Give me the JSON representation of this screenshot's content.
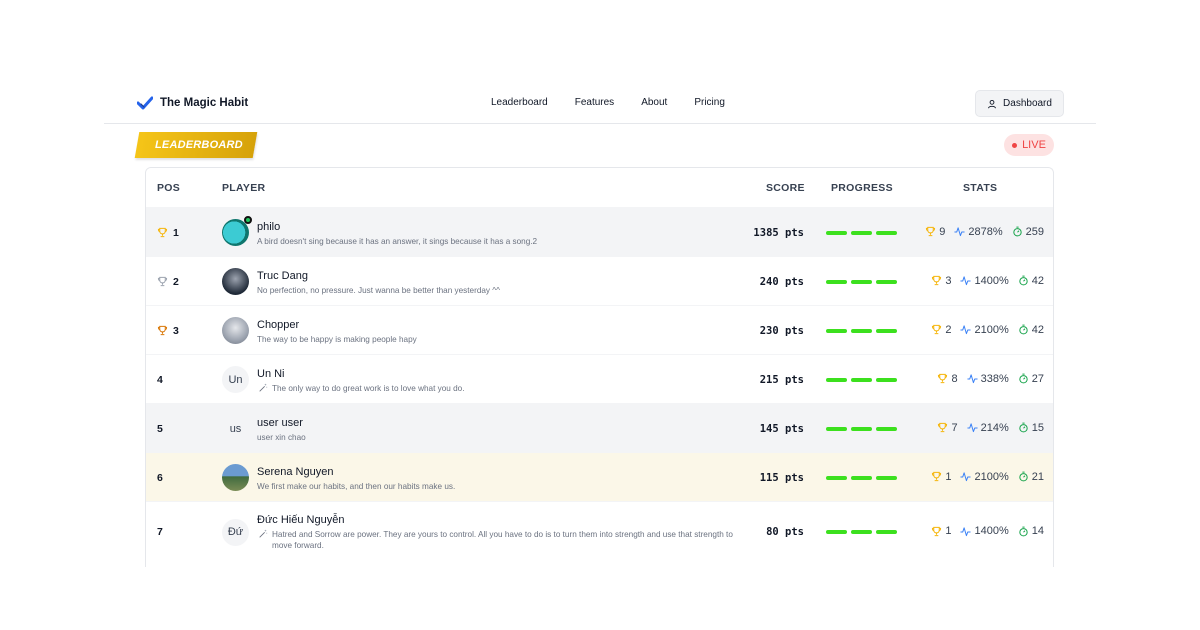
{
  "brand": {
    "name": "The Magic Habit"
  },
  "nav": {
    "links": [
      "Leaderboard",
      "Features",
      "About",
      "Pricing"
    ],
    "dashboard_label": "Dashboard"
  },
  "banner": {
    "title": "LEADERBOARD",
    "live_label": "LIVE"
  },
  "table": {
    "headers": {
      "pos": "POS",
      "player": "PLAYER",
      "score": "SCORE",
      "progress": "PROGRESS",
      "stats": "STATS"
    },
    "rows": [
      {
        "pos": "1",
        "trophy": "gold",
        "name": "philo",
        "bio": "A bird doesn't sing because it has an answer, it sings because it has a song.2",
        "avatar": "",
        "score": "1385 pts",
        "trophies": "9",
        "rate": "2878%",
        "time": "259",
        "progress": 1.0
      },
      {
        "pos": "2",
        "trophy": "silver",
        "name": "Truc Dang",
        "bio": "No perfection, no pressure. Just wanna be better than yesterday ^^",
        "avatar": "",
        "score": "240 pts",
        "trophies": "3",
        "rate": "1400%",
        "time": "42",
        "progress": 1.0
      },
      {
        "pos": "3",
        "trophy": "bronze",
        "name": "Chopper",
        "bio": "The way to be happy is making people hapy",
        "avatar": "",
        "score": "230 pts",
        "trophies": "2",
        "rate": "2100%",
        "time": "42",
        "progress": 1.0
      },
      {
        "pos": "4",
        "trophy": "",
        "name": "Un Ni",
        "bio": "The only way to do great work is to love what you do.",
        "avatar": "Un",
        "score": "215 pts",
        "trophies": "8",
        "rate": "338%",
        "time": "27",
        "progress": 1.0
      },
      {
        "pos": "5",
        "trophy": "",
        "name": "user user",
        "bio": "user xin chao",
        "avatar": "us",
        "score": "145 pts",
        "trophies": "7",
        "rate": "214%",
        "time": "15",
        "progress": 1.0
      },
      {
        "pos": "6",
        "trophy": "",
        "name": "Serena Nguyen",
        "bio": "We first make our habits, and then our habits make us.",
        "avatar": "",
        "score": "115 pts",
        "trophies": "1",
        "rate": "2100%",
        "time": "21",
        "progress": 1.0
      },
      {
        "pos": "7",
        "trophy": "",
        "name": "Đức Hiếu Nguyễn",
        "bio": "Hatred and Sorrow are power. They are yours to control. All you have to do is to turn them into strength and use that strength to move forward.",
        "avatar": "Đứ",
        "score": "80 pts",
        "trophies": "1",
        "rate": "1400%",
        "time": "14",
        "progress": 1.0
      }
    ]
  },
  "colors": {
    "accent": "#2563eb",
    "gold": "#f5c518",
    "progress": "#3ce01e",
    "live": "#ef4444",
    "highlight_row": "#fbf7e8"
  }
}
